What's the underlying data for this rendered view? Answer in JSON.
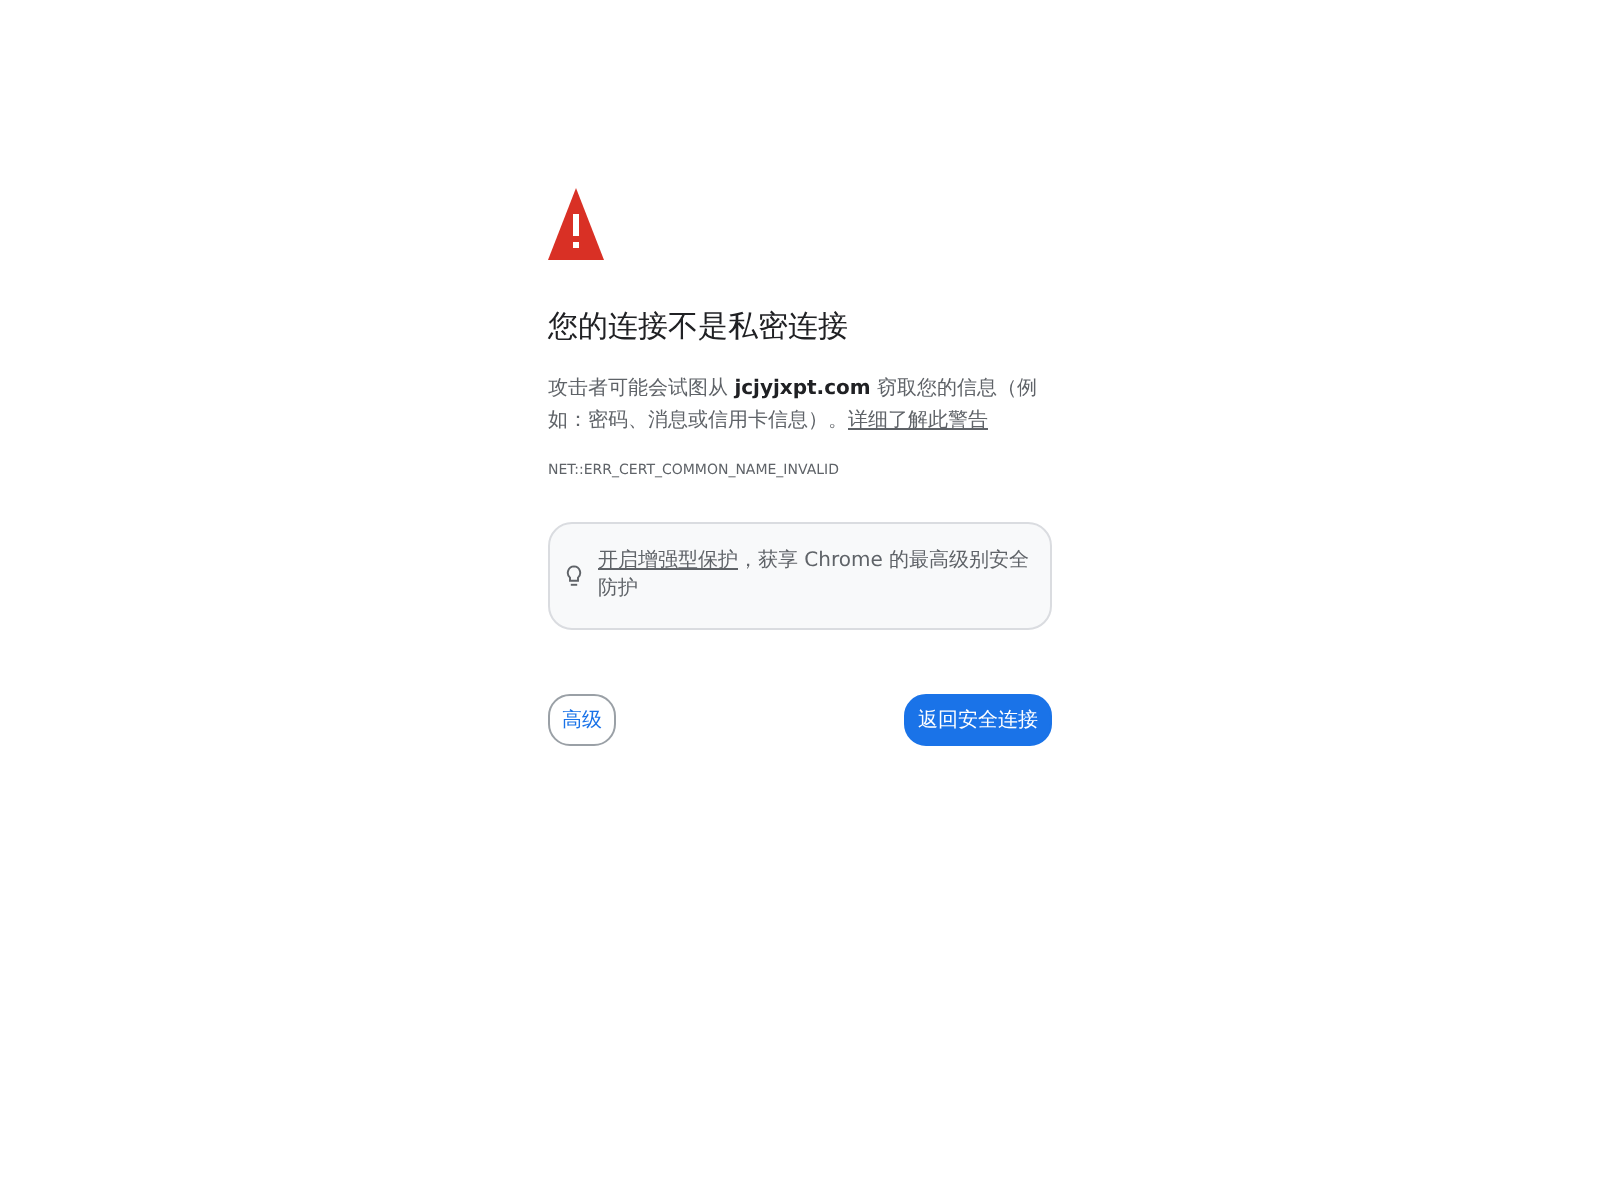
{
  "heading": "您的连接不是私密连接",
  "message": {
    "text": "攻击者可能会试图从 **jcjyjxpt.com** 窃取您的信息（例如：密码、消息或信用卡信息）。",
    "link": "详细了解此警告"
  },
  "error_code": "NET::ERR_CERT_COMMON_NAME_INVALID",
  "tip": {
    "link": "开启增强型保护",
    "text": "，获享 Chrome 的最高级别安全防护"
  },
  "buttons": [
    {
      "label": "高级",
      "kind": "secondary"
    },
    {
      "label": "返回安全连接",
      "kind": "primary"
    }
  ]
}
